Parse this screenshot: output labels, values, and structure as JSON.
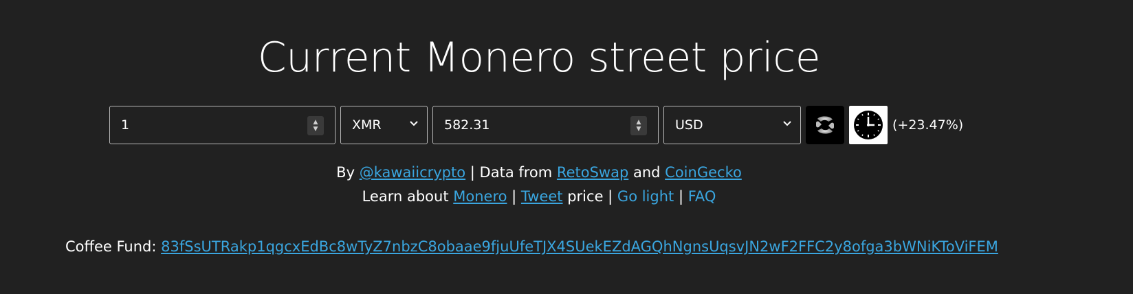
{
  "title": "Current Monero street price",
  "converter": {
    "from_amount": "1",
    "from_currency": "XMR",
    "to_amount": "582.31",
    "to_currency": "USD",
    "change": "(+23.47%)",
    "retoswap_icon": "retoswap-logo-icon",
    "history_icon": "clock-icon"
  },
  "credits": {
    "by": "By",
    "author": "@kawaiicrypto",
    "data_from": "| Data from",
    "source1": "RetoSwap",
    "and": "and",
    "source2": "CoinGecko",
    "learn": "Learn about",
    "monero": "Monero",
    "sep1": "|",
    "tweet": "Tweet",
    "price": "price |",
    "go_light": "Go light",
    "sep2": "|",
    "faq": "FAQ"
  },
  "fund": {
    "label": "Coffee Fund:",
    "address": "83fSsUTRakp1qgcxEdBc8wTyZ7nbzC8obaae9fjuUfeTJX4SUekEZdAGQhNgnsUqsvJN2wF2FFC2y8ofga3bWNiKToViFEM"
  },
  "colors": {
    "background": "#212121",
    "link": "#3aa6e0",
    "text": "#ffffff"
  }
}
